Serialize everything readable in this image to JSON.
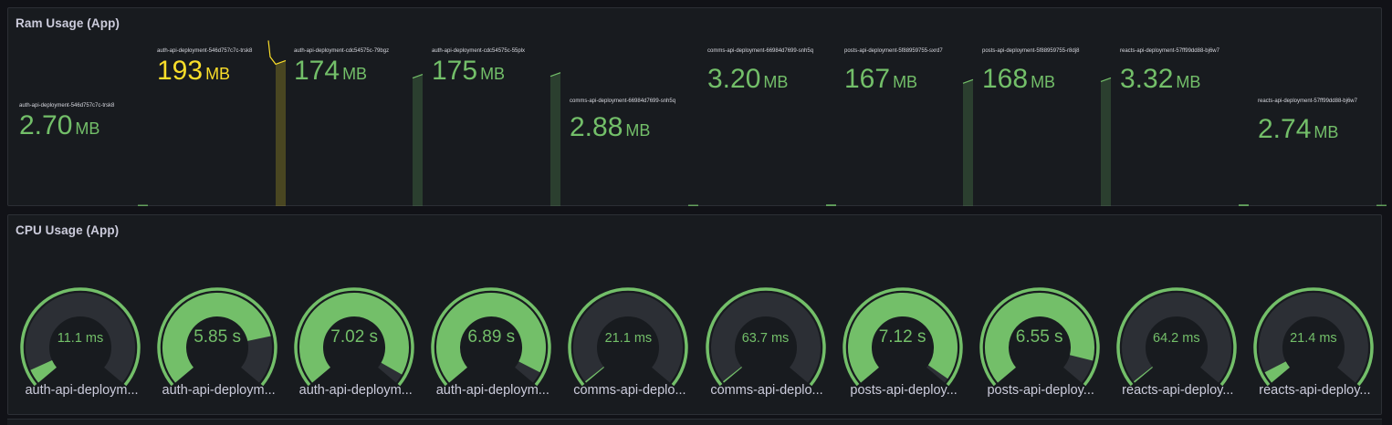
{
  "colors": {
    "green": "#73bf69",
    "yellow": "#fade2a",
    "gauge_track": "#2c2f35"
  },
  "ram_panel": {
    "title": "Ram Usage (App)",
    "stats": [
      {
        "label": "auth-api-deployment-546d757c7c-trsk8",
        "value": "2.70",
        "unit": "MB",
        "color": "#73bf69",
        "level": 0
      },
      {
        "label": "auth-api-deployment-546d757c7c-trsk8",
        "value": "193",
        "unit": "MB",
        "color": "#fade2a",
        "level": 0.84
      },
      {
        "label": "auth-api-deployment-cdc54575c-79bgz",
        "value": "174",
        "unit": "MB",
        "color": "#73bf69",
        "level": 0.76
      },
      {
        "label": "auth-api-deployment-cdc54575c-55plx",
        "value": "175",
        "unit": "MB",
        "color": "#73bf69",
        "level": 0.77
      },
      {
        "label": "comms-api-deployment-66984d7699-snh5q",
        "value": "2.88",
        "unit": "MB",
        "color": "#73bf69",
        "level": 0
      },
      {
        "label": "comms-api-deployment-66984d7699-snh5q",
        "value": "3.20",
        "unit": "MB",
        "color": "#73bf69",
        "level": 0.01
      },
      {
        "label": "posts-api-deployment-5f88959755-sxrd7",
        "value": "167",
        "unit": "MB",
        "color": "#73bf69",
        "level": 0.73
      },
      {
        "label": "posts-api-deployment-5f88959755-r8dj8",
        "value": "168",
        "unit": "MB",
        "color": "#73bf69",
        "level": 0.74
      },
      {
        "label": "reacts-api-deployment-57ff99dd88-bj6w7",
        "value": "3.32",
        "unit": "MB",
        "color": "#73bf69",
        "level": 0.01
      },
      {
        "label": "reacts-api-deployment-57ff99dd88-bj6w7",
        "value": "2.74",
        "unit": "MB",
        "color": "#73bf69",
        "level": 0
      }
    ]
  },
  "cpu_panel": {
    "title": "CPU Usage (App)",
    "gauges": [
      {
        "name": "auth-api-deploym...",
        "value": "11.1 ms",
        "fraction": 0.06
      },
      {
        "name": "auth-api-deploym...",
        "value": "5.85 s",
        "fraction": 0.8
      },
      {
        "name": "auth-api-deploym...",
        "value": "7.02 s",
        "fraction": 0.96
      },
      {
        "name": "auth-api-deploym...",
        "value": "6.89 s",
        "fraction": 0.95
      },
      {
        "name": "comms-api-deplo...",
        "value": "21.1 ms",
        "fraction": 0.0
      },
      {
        "name": "comms-api-deplo...",
        "value": "63.7 ms",
        "fraction": 0.0
      },
      {
        "name": "posts-api-deploy...",
        "value": "7.12 s",
        "fraction": 0.98
      },
      {
        "name": "posts-api-deploy...",
        "value": "6.55 s",
        "fraction": 0.9
      },
      {
        "name": "reacts-api-deploy...",
        "value": "64.2 ms",
        "fraction": 0.0
      },
      {
        "name": "reacts-api-deploy...",
        "value": "21.4 ms",
        "fraction": 0.05
      }
    ]
  }
}
